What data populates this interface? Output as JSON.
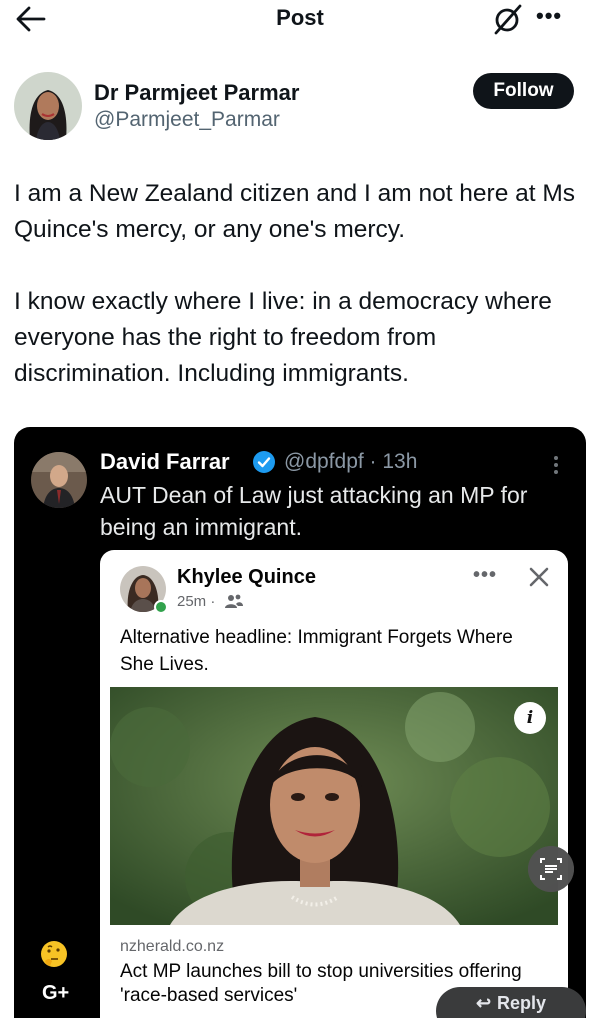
{
  "topbar": {
    "title": "Post",
    "back_icon": "arrow-left-icon",
    "grok_icon": "grok-icon",
    "more_icon": "more-horizontal-icon",
    "more_label": "•••"
  },
  "author": {
    "name": "Dr Parmjeet Parmar",
    "handle": "@Parmjeet_Parmar",
    "follow_label": "Follow"
  },
  "tweet": {
    "paragraphs": [
      "I am a New Zealand citizen and I am not here at Ms Quince's mercy, or any one's mercy.",
      "I know exactly where I live: in a democracy where everyone has the right to freedom from discrimination. Including immigrants."
    ]
  },
  "embedded": {
    "author_name": "David Farrar",
    "handle_time": "@dpfdpf · 13h",
    "text": "AUT Dean of Law just attacking an MP for being an immigrant.",
    "card": {
      "author_name": "Khylee Quince",
      "time": "25m ·",
      "more_label": "•••",
      "text": "Alternative headline: Immigrant Forgets Where She Lives.",
      "info_label": "i",
      "source": "nzherald.co.nz",
      "headline": "Act MP launches bill to stop universities offering 'race-based services'"
    },
    "reply_label": "Reply",
    "plus_label": "G+"
  },
  "colors": {
    "text": "#0f1419",
    "secondary": "#536471",
    "verified": "#1d9bf0",
    "online": "#31a24c"
  }
}
